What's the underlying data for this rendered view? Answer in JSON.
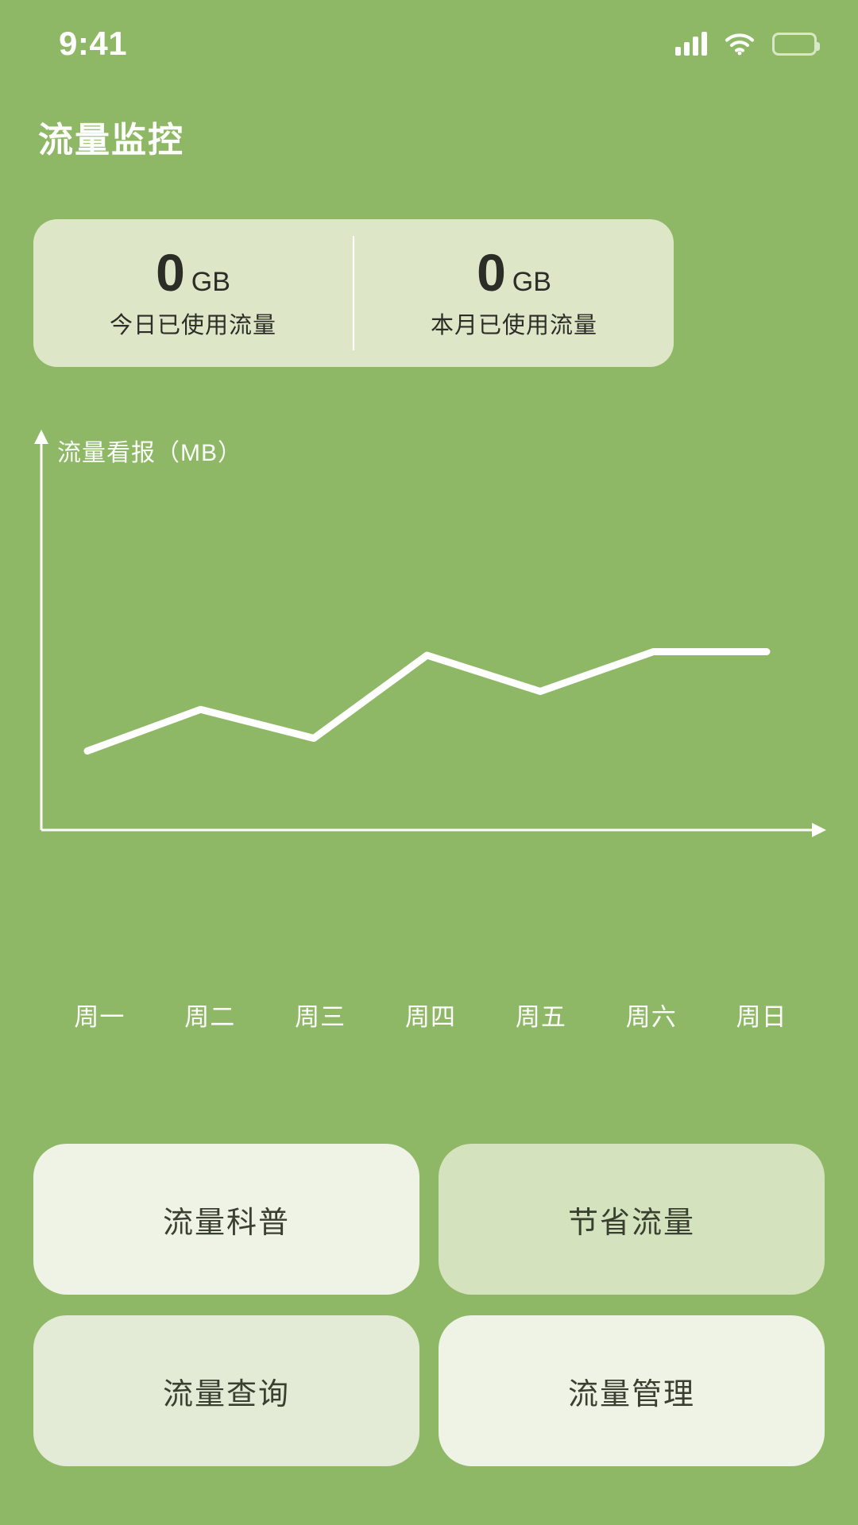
{
  "theme": {
    "background": "#8fb866",
    "card_background": "#dde7c8",
    "text_on_green": "#ffffff",
    "text_dark": "#2b2e26",
    "line_color": "#ffffff"
  },
  "status_bar": {
    "time": "9:41",
    "icons": [
      "signal-icon",
      "wifi-icon",
      "battery-icon"
    ]
  },
  "header": {
    "title": "流量监控"
  },
  "stats": [
    {
      "number": "0",
      "unit": "GB",
      "label": "今日已使用流量"
    },
    {
      "number": "0",
      "unit": "GB",
      "label": "本月已使用流量"
    }
  ],
  "chart_data": {
    "type": "line",
    "title": "流量看报（MB）",
    "ylabel": "流量看报（MB）",
    "xlabel": "",
    "categories": [
      "周一",
      "周二",
      "周三",
      "周四",
      "周五",
      "周六",
      "周日"
    ],
    "values": [
      35,
      58,
      42,
      88,
      68,
      90,
      90
    ],
    "ylim": [
      0,
      110
    ],
    "grid": false,
    "legend": "none",
    "series": [
      {
        "name": "流量看报",
        "values": [
          35,
          58,
          42,
          88,
          68,
          90,
          90
        ]
      }
    ]
  },
  "tiles": [
    {
      "label": "流量科普",
      "background": "#eef3e6"
    },
    {
      "label": "节省流量",
      "background": "#d4e2bd"
    },
    {
      "label": "流量查询",
      "background": "#e3ead5"
    },
    {
      "label": "流量管理",
      "background": "#eef3e6"
    }
  ]
}
